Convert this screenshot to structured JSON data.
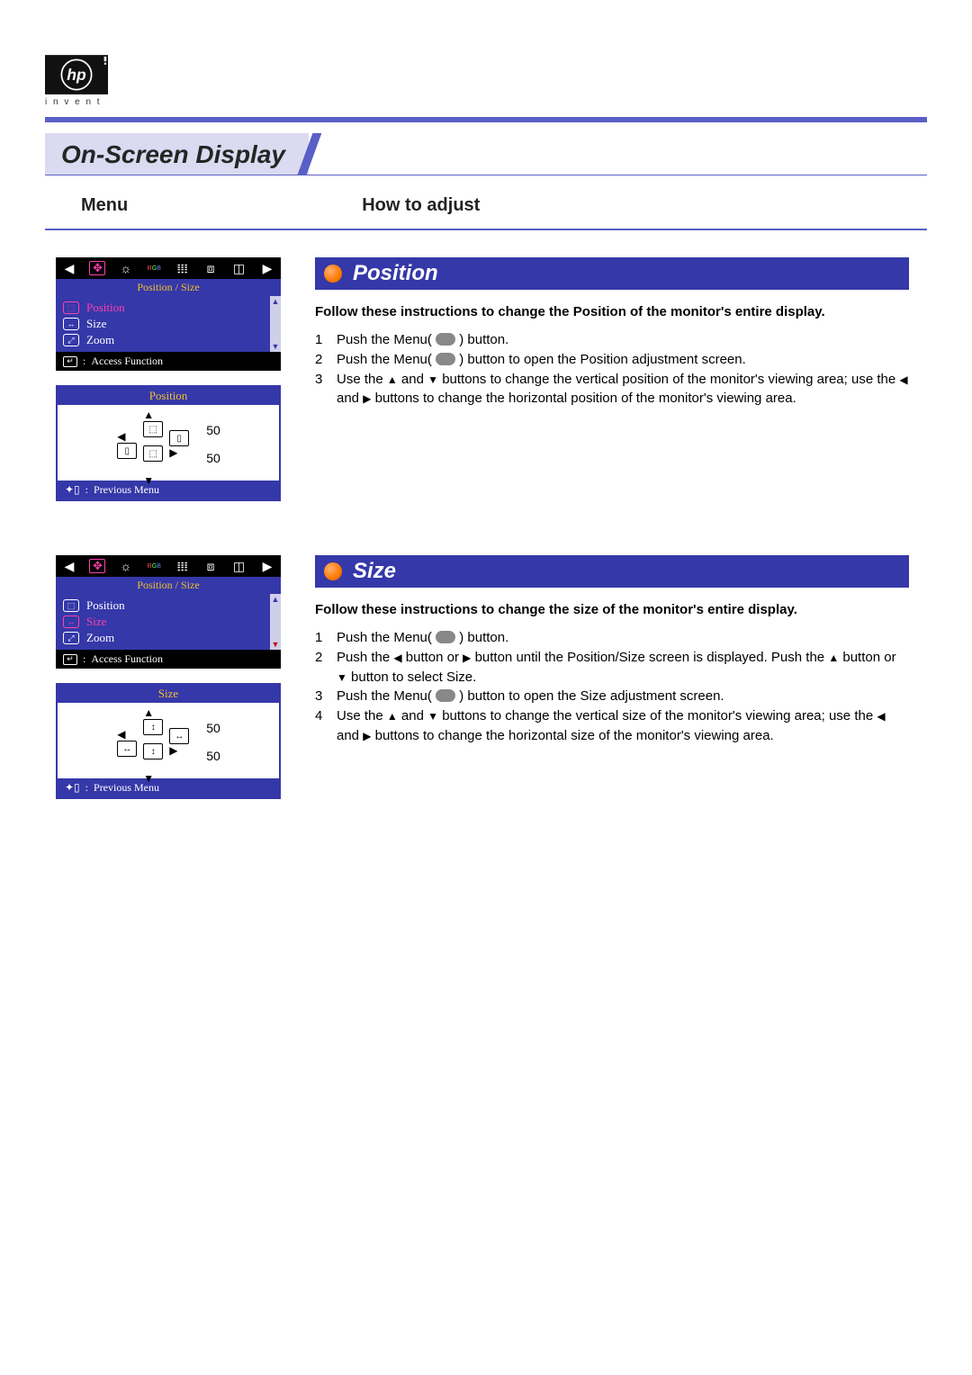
{
  "logo_subtext": "i n v e n t",
  "page_title": "On-Screen Display",
  "subhead": {
    "menu": "Menu",
    "how": "How to adjust"
  },
  "osd_menu": {
    "subtitle": "Position / Size",
    "items": {
      "position": "Position",
      "size": "Size",
      "zoom": "Zoom"
    },
    "footer": "Access Function"
  },
  "adj": {
    "previous": "Previous Menu",
    "val_h": "50",
    "val_v": "50",
    "title_position": "Position",
    "title_size": "Size"
  },
  "sections": {
    "position": {
      "heading": "Position",
      "intro": "Follow these instructions to change the Position of the monitor's entire display.",
      "step1a": "Push the Menu(",
      "step1b": ") button.",
      "step2a": "Push the Menu(",
      "step2b": ") button to open the Position adjustment screen.",
      "step3a": "Use the ",
      "step3b": " and ",
      "step3c": " buttons to change the vertical position of the monitor's viewing area; use the ",
      "step3d": " and ",
      "step3e": " buttons to change the horizontal position of the monitor's viewing area."
    },
    "size": {
      "heading": "Size",
      "intro": "Follow these instructions to change the size of the monitor's entire display.",
      "step1a": "Push the Menu(",
      "step1b": ") button.",
      "step2a": "Push the ",
      "step2b": " button or ",
      "step2c": " button until the Position/Size screen is displayed. Push the ",
      "step2d": " button or ",
      "step2e": " button to select Size.",
      "step3a": "Push the Menu(",
      "step3b": ") button to open the Size adjustment screen.",
      "step4a": "Use the ",
      "step4b": " and ",
      "step4c": " buttons to change the vertical size of the monitor's viewing area; use the ",
      "step4d": " and ",
      "step4e": " buttons to change the horizontal size of the monitor's viewing area."
    }
  }
}
